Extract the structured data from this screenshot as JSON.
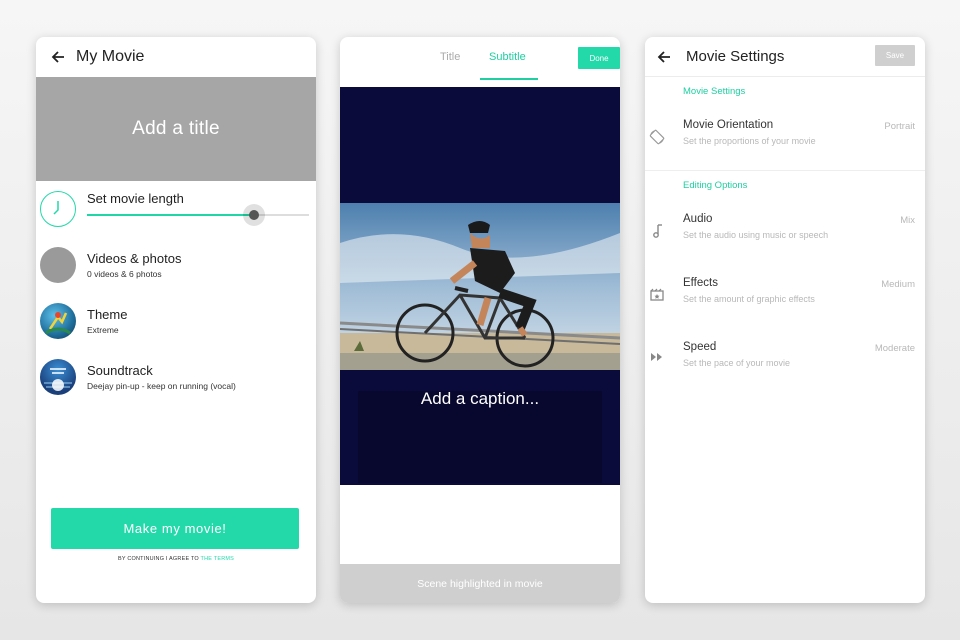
{
  "screen1": {
    "header_title": "My Movie",
    "title_placeholder": "Add a title",
    "movie_length_label": "Set movie length",
    "movie_length_fraction": 0.75,
    "videos_title": "Videos & photos",
    "videos_sub": "0 videos  & 6 photos",
    "theme_title": "Theme",
    "theme_sub": "Extreme",
    "soundtrack_title": "Soundtrack",
    "soundtrack_sub": "Deejay pin-up - keep on running (vocal)",
    "cta_label": "Make my movie!",
    "terms_prefix": "BY CONTINUING I AGREE TO",
    "terms_link": "THE TERMS",
    "accent_color": "#23d9a9"
  },
  "screen2": {
    "tab_title": "Title",
    "tab_subtitle": "Subtitle",
    "done_label": "Done",
    "caption_placeholder": "Add a caption...",
    "footer_text": "Scene highlighted in movie"
  },
  "screen3": {
    "header_title": "Movie Settings",
    "save_label": "Save",
    "section1_label": "Movie Settings",
    "section2_label": "Editing Options",
    "settings": [
      {
        "title": "Movie Orientation",
        "sub": "Set the proportions of your movie",
        "value": "Portrait",
        "icon": "orientation-icon"
      },
      {
        "title": "Audio",
        "sub": "Set the audio using music or speech",
        "value": "Mix",
        "icon": "music-note-icon"
      },
      {
        "title": "Effects",
        "sub": "Set the amount of graphic effects",
        "value": "Medium",
        "icon": "film-effects-icon"
      },
      {
        "title": "Speed",
        "sub": "Set the pace of your movie",
        "value": "Moderate",
        "icon": "fast-forward-icon"
      }
    ]
  }
}
